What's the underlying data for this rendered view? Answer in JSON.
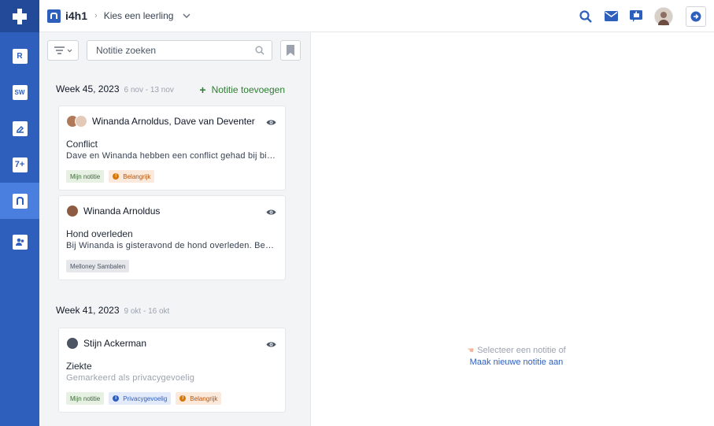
{
  "topbar": {
    "brand": "i4h1",
    "breadcrumb": "Kies een leerling",
    "icons": [
      "search-icon",
      "mail-icon",
      "thumbs-up-icon",
      "avatar",
      "logout-icon"
    ]
  },
  "leftnav": {
    "items": [
      {
        "name": "rooster",
        "icon": "R"
      },
      {
        "name": "studiewijzer",
        "icon": "SW"
      },
      {
        "name": "opdrachten",
        "icon": "edit"
      },
      {
        "name": "cijfers",
        "icon": "7+"
      },
      {
        "name": "notities",
        "icon": "n",
        "active": true
      },
      {
        "name": "leerlingen",
        "icon": "people"
      }
    ]
  },
  "search": {
    "placeholder": "Notitie zoeken"
  },
  "add_note_label": "Notitie toevoegen",
  "weeks": [
    {
      "title": "Week 45, 2023",
      "range": "6 nov - 13 nov",
      "notes": [
        {
          "people": "Winanda Arnoldus, Dave van Deventer",
          "title": "Conflict",
          "snippet": "Dave en Winanda hebben een conflict gehad bij biologie",
          "tags": [
            {
              "label": "Mijn notitie",
              "style": "green"
            },
            {
              "label": "Belangrijk",
              "style": "orange"
            }
          ]
        },
        {
          "people": "Winanda Arnoldus",
          "title": "Hond overleden",
          "snippet": "Bij Winanda is gisteravond de hond overleden. Beetje rustig aan doen",
          "tags": [
            {
              "label": "Melloney Sambalen",
              "style": "gray"
            }
          ]
        }
      ]
    },
    {
      "title": "Week 41, 2023",
      "range": "9 okt - 16 okt",
      "notes": [
        {
          "people": "Stijn Ackerman",
          "title": "Ziekte",
          "snippet": "Gemarkeerd als privacygevoelig",
          "tags": [
            {
              "label": "Mijn notitie",
              "style": "green"
            },
            {
              "label": "Privacygevoelig",
              "style": "blue"
            },
            {
              "label": "Belangrijk",
              "style": "orange"
            }
          ]
        }
      ]
    }
  ],
  "detail": {
    "empty_text": "Selecteer een notitie of",
    "empty_link": "Maak nieuwe notitie aan"
  },
  "colors": {
    "nav_bg": "#2f5fbd",
    "accent_blue": "#2f5fbd",
    "add_green": "#2e7d32"
  }
}
